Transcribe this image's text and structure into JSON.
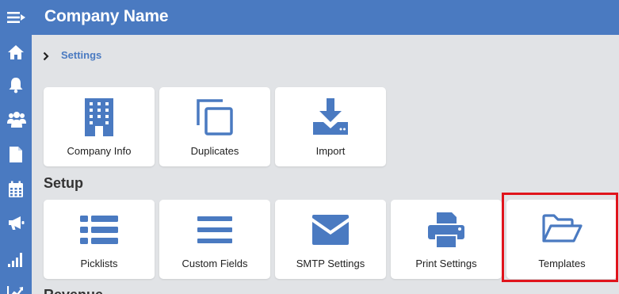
{
  "header": {
    "company_name": "Company Name"
  },
  "sidebar": {
    "items": [
      {
        "icon": "home-icon"
      },
      {
        "icon": "bell-icon"
      },
      {
        "icon": "users-icon"
      },
      {
        "icon": "document-icon"
      },
      {
        "icon": "calendar-icon"
      },
      {
        "icon": "megaphone-icon"
      },
      {
        "icon": "signal-bars-icon"
      },
      {
        "icon": "trend-chart-icon"
      }
    ]
  },
  "breadcrumb": {
    "label": "Settings"
  },
  "tiles_top": [
    {
      "label": "Company Info",
      "icon": "building-icon"
    },
    {
      "label": "Duplicates",
      "icon": "duplicate-icon"
    },
    {
      "label": "Import",
      "icon": "import-icon"
    }
  ],
  "setup": {
    "title": "Setup",
    "tiles": [
      {
        "label": "Picklists",
        "icon": "list-icon"
      },
      {
        "label": "Custom Fields",
        "icon": "bars-icon"
      },
      {
        "label": "SMTP Settings",
        "icon": "envelope-icon"
      },
      {
        "label": "Print Settings",
        "icon": "printer-icon"
      },
      {
        "label": "Templates",
        "icon": "folder-open-icon"
      }
    ]
  },
  "revenue": {
    "title": "Revenue"
  },
  "colors": {
    "brand": "#4a7ac1",
    "highlight": "#e0141c",
    "background": "#e1e3e6"
  }
}
